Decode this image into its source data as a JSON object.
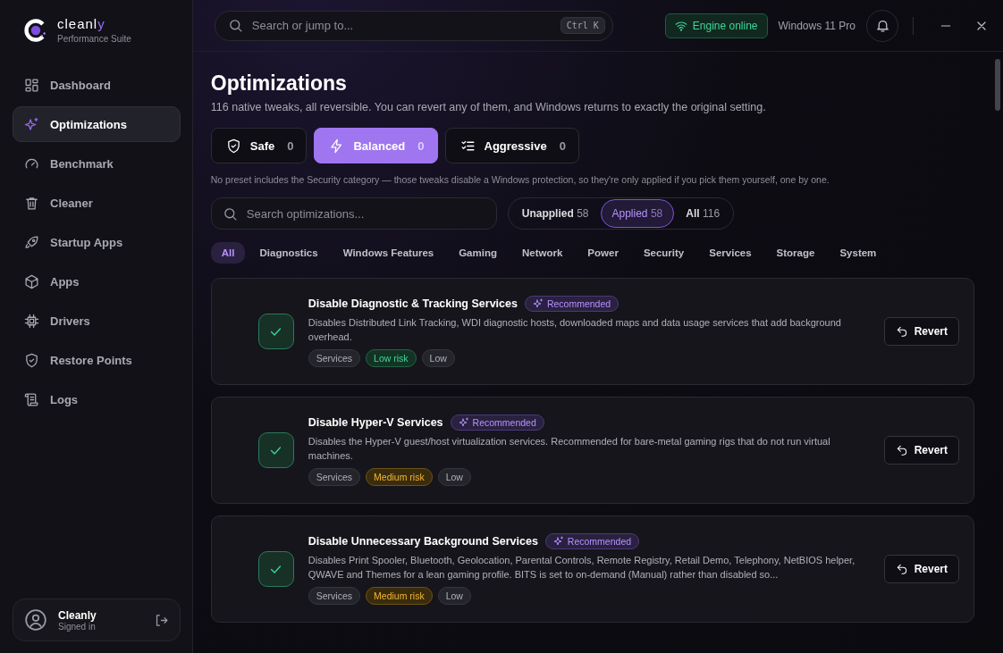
{
  "brand": {
    "name": "cleanl",
    "accent": "y",
    "subtitle": "Performance Suite"
  },
  "sidebar": {
    "items": [
      {
        "label": "Dashboard",
        "selected": false
      },
      {
        "label": "Optimizations",
        "selected": true
      },
      {
        "label": "Benchmark",
        "selected": false
      },
      {
        "label": "Cleaner",
        "selected": false
      },
      {
        "label": "Startup Apps",
        "selected": false
      },
      {
        "label": "Apps",
        "selected": false
      },
      {
        "label": "Drivers",
        "selected": false
      },
      {
        "label": "Restore Points",
        "selected": false
      },
      {
        "label": "Logs",
        "selected": false
      }
    ],
    "user": {
      "name": "Cleanly",
      "status": "Signed in"
    }
  },
  "topbar": {
    "search": {
      "placeholder": "Search or jump to...",
      "shortcut": "Ctrl K"
    },
    "engine_status": {
      "label": "Engine online",
      "on": true
    },
    "os": "Windows 11 Pro"
  },
  "page": {
    "title": "Optimizations",
    "subtitle": "116 native tweaks, all reversible. You can revert any of them, and Windows returns to exactly the original setting.",
    "presets": [
      {
        "label": "Safe",
        "count": "0",
        "selected": false
      },
      {
        "label": "Balanced",
        "count": "0",
        "selected": true
      },
      {
        "label": "Aggressive",
        "count": "0",
        "selected": false
      }
    ],
    "note": "No preset includes the Security category — those tweaks disable a Windows protection, so they're only applied if you pick them yourself, one by one.",
    "search": {
      "placeholder": "Search optimizations..."
    },
    "filters": [
      {
        "label": "Unapplied",
        "count": "58",
        "selected": false
      },
      {
        "label": "Applied",
        "count": "58",
        "selected": true
      },
      {
        "label": "All",
        "count": "116",
        "selected": false
      }
    ],
    "categories": [
      {
        "label": "All",
        "selected": true
      },
      {
        "label": "Diagnostics",
        "selected": false
      },
      {
        "label": "Windows Features",
        "selected": false
      },
      {
        "label": "Gaming",
        "selected": false
      },
      {
        "label": "Network",
        "selected": false
      },
      {
        "label": "Power",
        "selected": false
      },
      {
        "label": "Security",
        "selected": false
      },
      {
        "label": "Services",
        "selected": false
      },
      {
        "label": "Storage",
        "selected": false
      },
      {
        "label": "System",
        "selected": false
      }
    ],
    "tweaks": [
      {
        "title": "Disable Diagnostic & Tracking Services",
        "badge": "Recommended",
        "description": "Disables Distributed Link Tracking, WDI diagnostic hosts, downloaded maps and data usage services that add background overhead.",
        "applied": true,
        "tags": [
          {
            "label": "Services",
            "kind": "plain"
          },
          {
            "label": "Low risk",
            "kind": "low"
          },
          {
            "label": "Low",
            "kind": "plain"
          }
        ],
        "action": "Revert"
      },
      {
        "title": "Disable Hyper-V Services",
        "badge": "Recommended",
        "description": "Disables the Hyper-V guest/host virtualization services. Recommended for bare-metal gaming rigs that do not run virtual machines.",
        "applied": true,
        "tags": [
          {
            "label": "Services",
            "kind": "plain"
          },
          {
            "label": "Medium risk",
            "kind": "medium"
          },
          {
            "label": "Low",
            "kind": "plain"
          }
        ],
        "action": "Revert"
      },
      {
        "title": "Disable Unnecessary Background Services",
        "badge": "Recommended",
        "description": "Disables Print Spooler, Bluetooth, Geolocation, Parental Controls, Remote Registry, Retail Demo, Telephony, NetBIOS helper, QWAVE and Themes for a lean gaming profile. BITS is set to on-demand (Manual) rather than disabled so...",
        "applied": true,
        "tags": [
          {
            "label": "Services",
            "kind": "plain"
          },
          {
            "label": "Medium risk",
            "kind": "medium"
          },
          {
            "label": "Low",
            "kind": "plain"
          }
        ],
        "action": "Revert"
      }
    ]
  }
}
